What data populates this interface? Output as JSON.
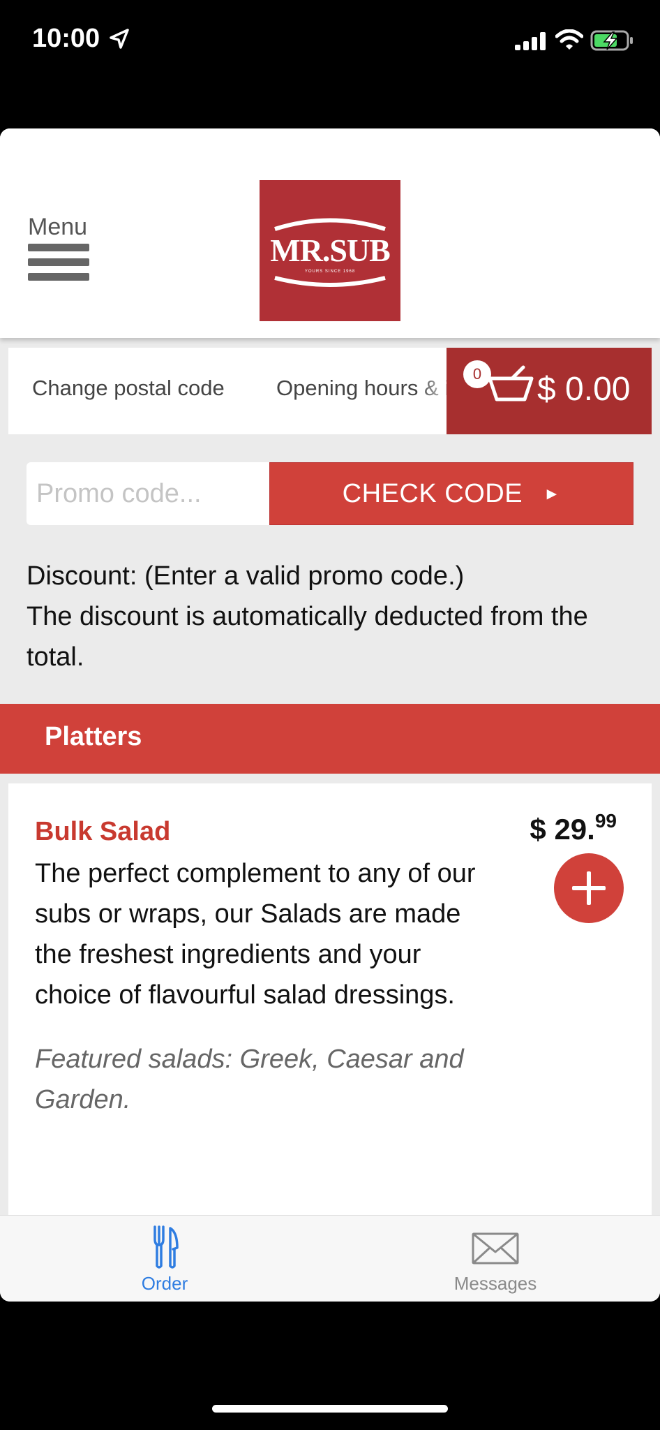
{
  "status_bar": {
    "time": "10:00"
  },
  "header": {
    "menu_label": "Menu",
    "logo_text": "MR.SUB",
    "logo_tagline": "YOURS SINCE 1968",
    "brand_color": "#b03036"
  },
  "action_row": {
    "change_postal_label": "Change postal code",
    "opening_hours_label": "Opening hours & info",
    "cart_count": "0",
    "cart_total": "$ 0.00"
  },
  "promo": {
    "placeholder": "Promo code...",
    "value": "",
    "check_label": "CHECK CODE",
    "arrow": "►"
  },
  "discount": {
    "line1": "Discount: (Enter a valid promo code.)",
    "line2": "The discount is automatically deducted from the total."
  },
  "category": {
    "title": "Platters"
  },
  "product": {
    "name": "Bulk Salad",
    "description": "The perfect complement to any of our subs or wraps, our Salads are made the freshest ingredients and your choice of flavourful salad dressings.",
    "featured": "Featured salads: Greek, Caesar and Garden.",
    "price_main": "$ 29.",
    "price_cents": "99"
  },
  "tabbar": {
    "tabs": [
      {
        "label": "Order",
        "icon": "fork-knife-icon",
        "active": true
      },
      {
        "label": "Messages",
        "icon": "envelope-icon",
        "active": false
      }
    ]
  },
  "colors": {
    "accent": "#d0413a",
    "cart_bg": "#a72f2f",
    "active_tab": "#2f7de1",
    "product_name": "#c8392f"
  }
}
